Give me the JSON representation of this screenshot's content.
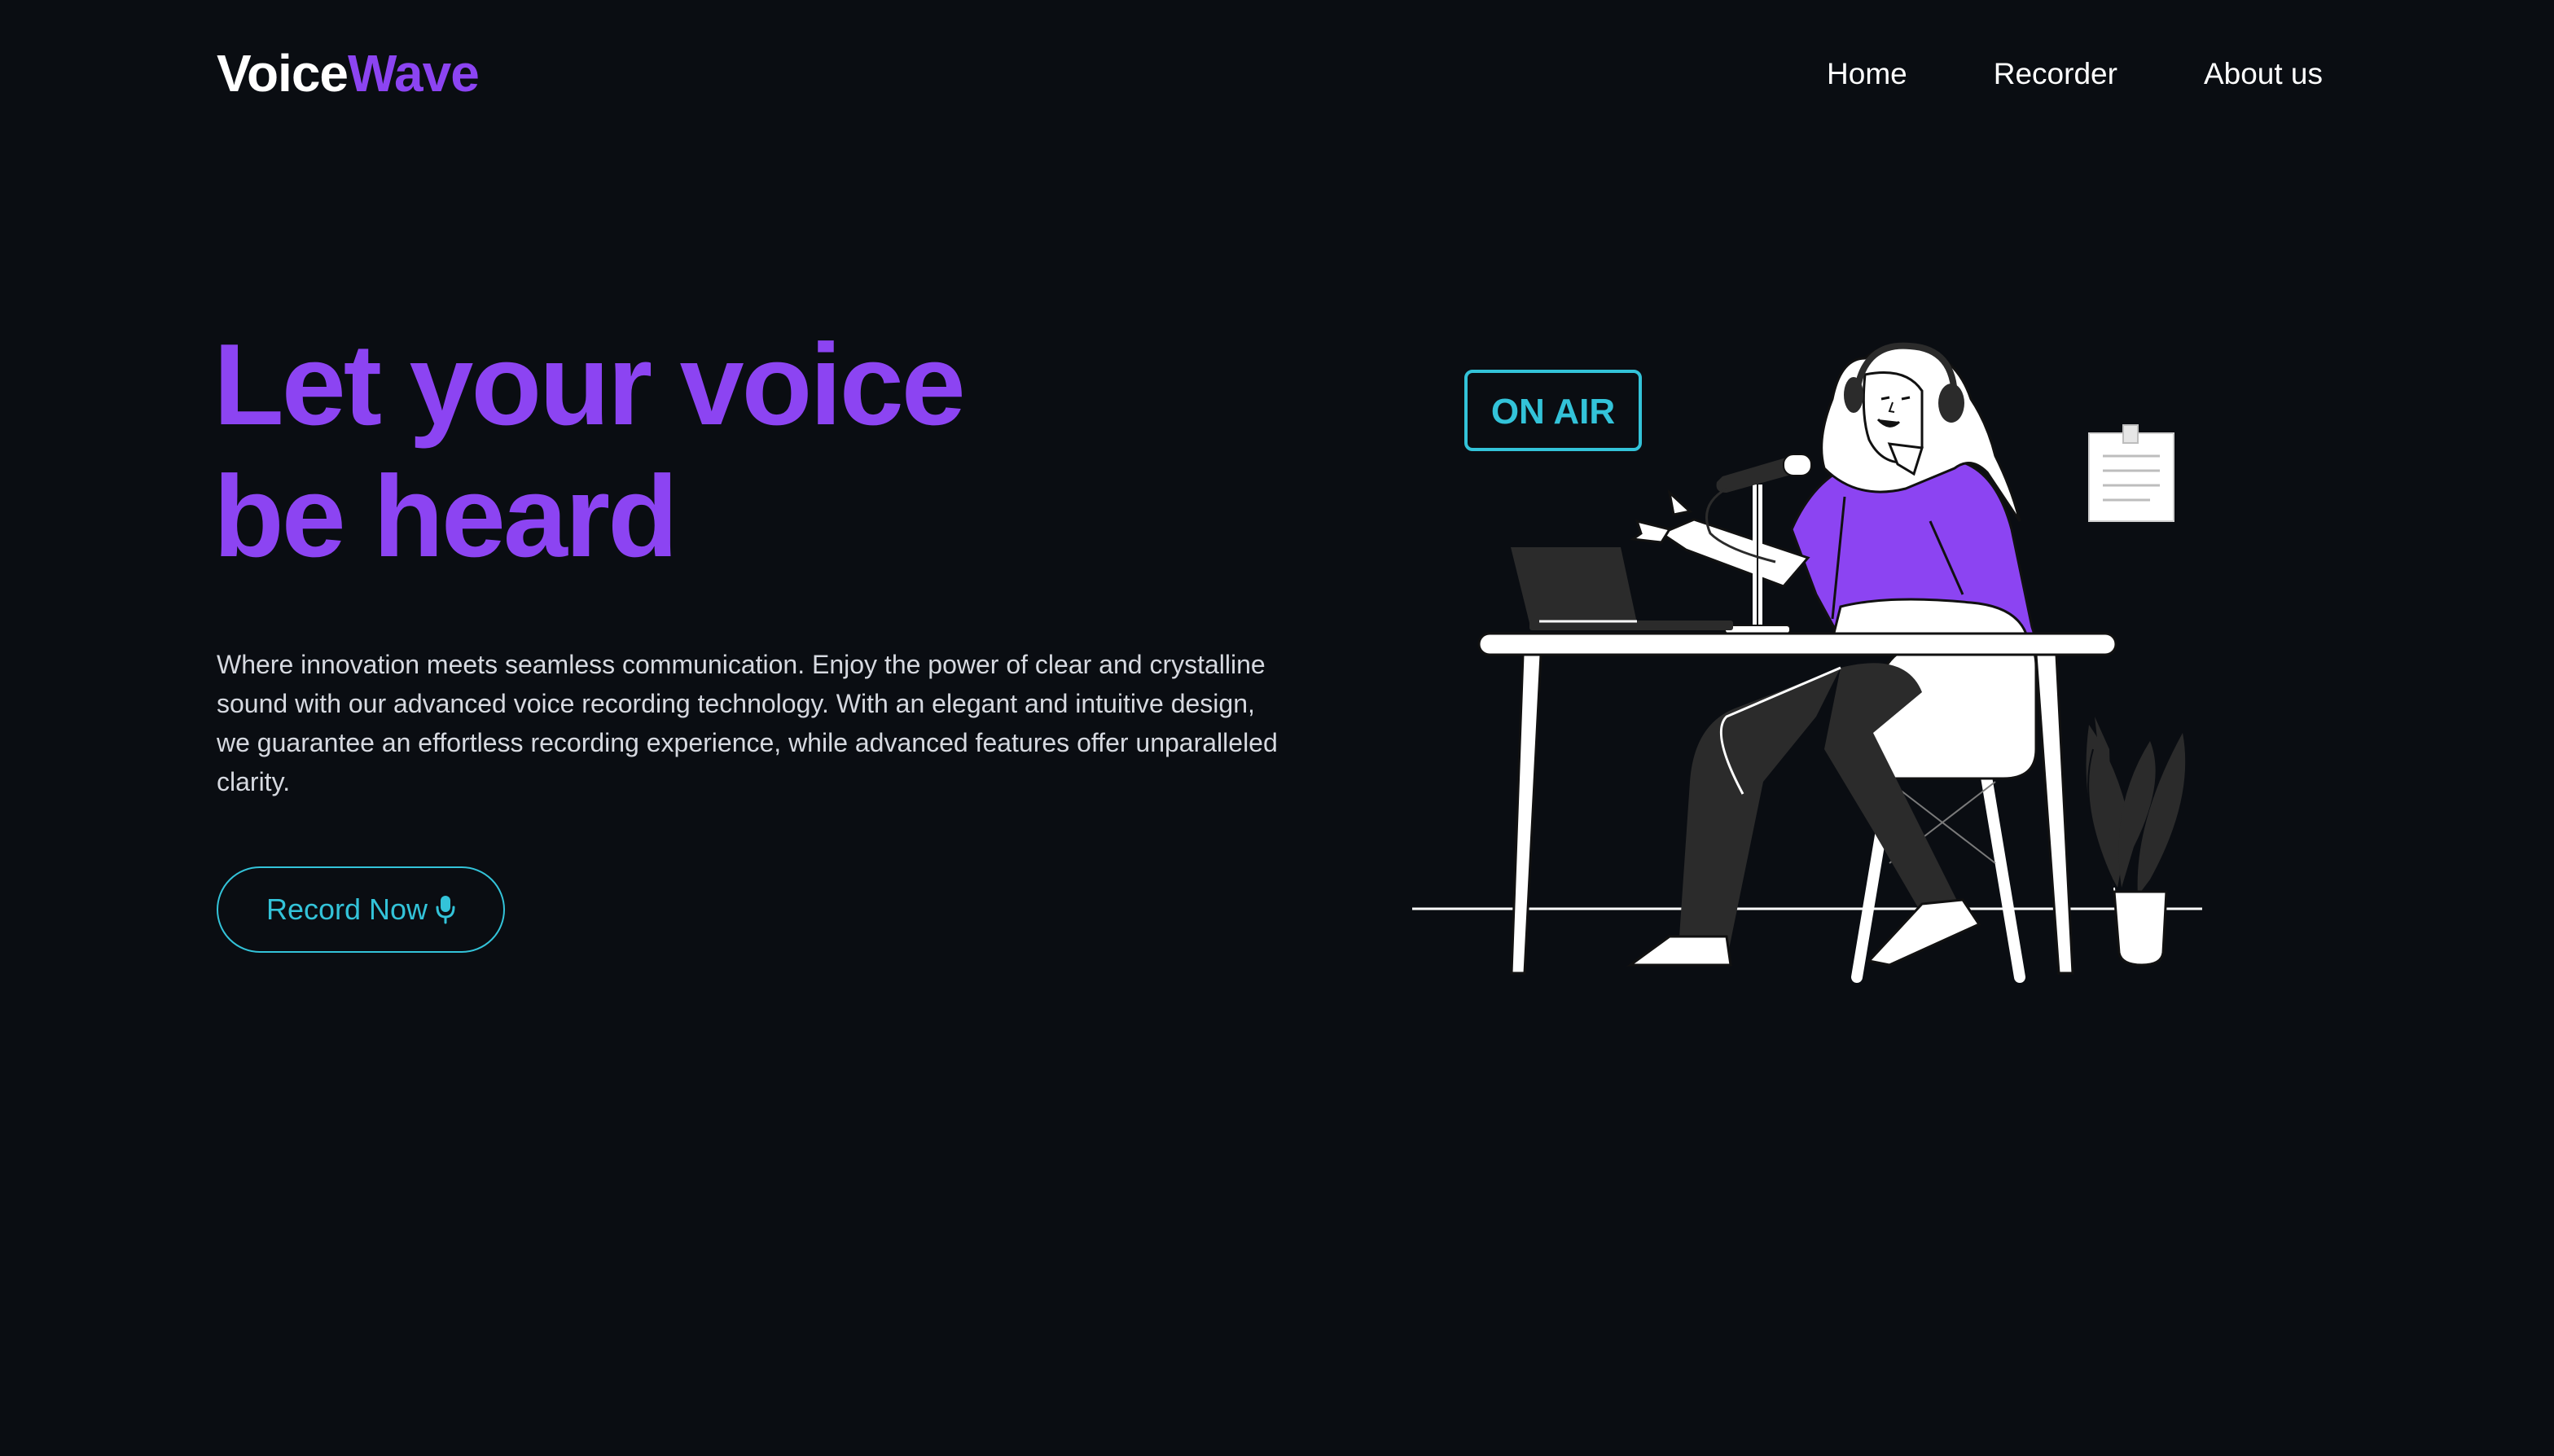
{
  "brand": {
    "part1": "Voice",
    "part2": "Wave"
  },
  "nav": {
    "items": [
      {
        "label": "Home"
      },
      {
        "label": "Recorder"
      },
      {
        "label": "About us"
      }
    ]
  },
  "hero": {
    "title_line1": "Let your voice",
    "title_line2": "be heard",
    "description": "Where innovation meets seamless communication. Enjoy the power of clear and crystalline sound with our advanced voice recording technology. With an elegant and intuitive design, we guarantee an effortless recording experience, while advanced features offer unparalleled clarity.",
    "cta_label": "Record Now",
    "cta_icon": "microphone-icon"
  },
  "illustration": {
    "sign_text": "ON AIR"
  },
  "colors": {
    "background": "#0a0d12",
    "accent": "#8c44f2",
    "cyan": "#33c3d9",
    "text": "#ffffff",
    "muted": "#d6d9e0"
  }
}
